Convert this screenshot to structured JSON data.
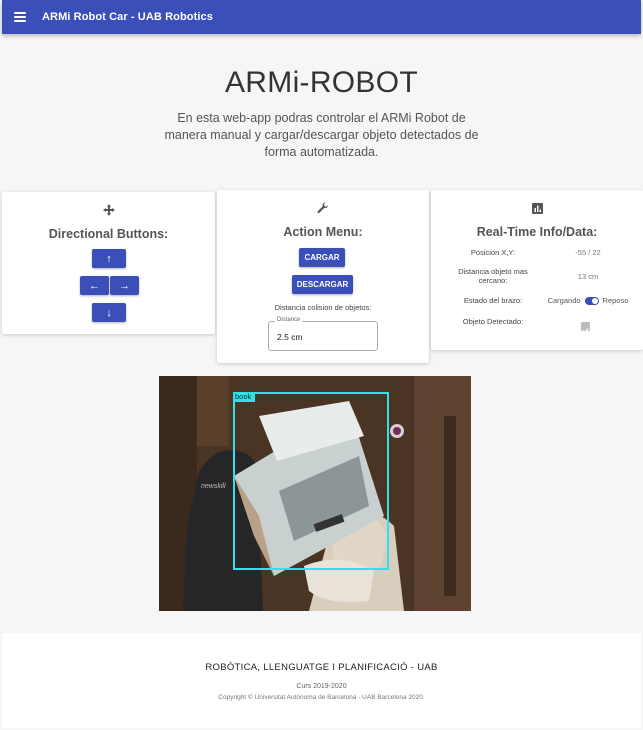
{
  "appbar": {
    "title": "ARMi Robot Car - UAB Robotics"
  },
  "hero": {
    "title": "ARMi-ROBOT",
    "description": "En esta web-app podras controlar el ARMi Robot de manera manual y cargar/descargar objeto detectados de forma automatizada."
  },
  "directional": {
    "title": "Directional Buttons:",
    "icon": "move-icon",
    "up": "↑",
    "left": "←",
    "right": "→",
    "down": "↓"
  },
  "actions": {
    "title": "Action Menu:",
    "icon": "wrench-icon",
    "cargar": "CARGAR",
    "descargar": "DESCARGAR",
    "distance_label": "Distancia colision de objetos:",
    "distance_field_label": "Distance",
    "distance_value": "2.5 cm"
  },
  "info": {
    "title": "Real-Time Info/Data:",
    "icon": "chart-icon",
    "rows": [
      {
        "label": "Posicion X,Y:",
        "value": "-55 / 22"
      },
      {
        "label": "Distancia objeto mas cercano:",
        "value": "13 cm"
      }
    ],
    "arm_label": "Estado del brazo:",
    "arm_left": "Cargando",
    "arm_right": "Reposo",
    "detected_label": "Objeto Detectado:",
    "detected_checked": true
  },
  "camera": {
    "detection_label": "book",
    "box_color": "#31e0e8"
  },
  "footer": {
    "title": "ROBÒTICA, LLENGUATGE I PLANIFICACIÓ - UAB",
    "course": "Curs 2019-2020",
    "copyright": "Copyright © Universitat Autònoma de Barcelona - UAB Barcelona 2020."
  },
  "colors": {
    "primary": "#3a4fb8",
    "background": "#f6f6f6"
  }
}
